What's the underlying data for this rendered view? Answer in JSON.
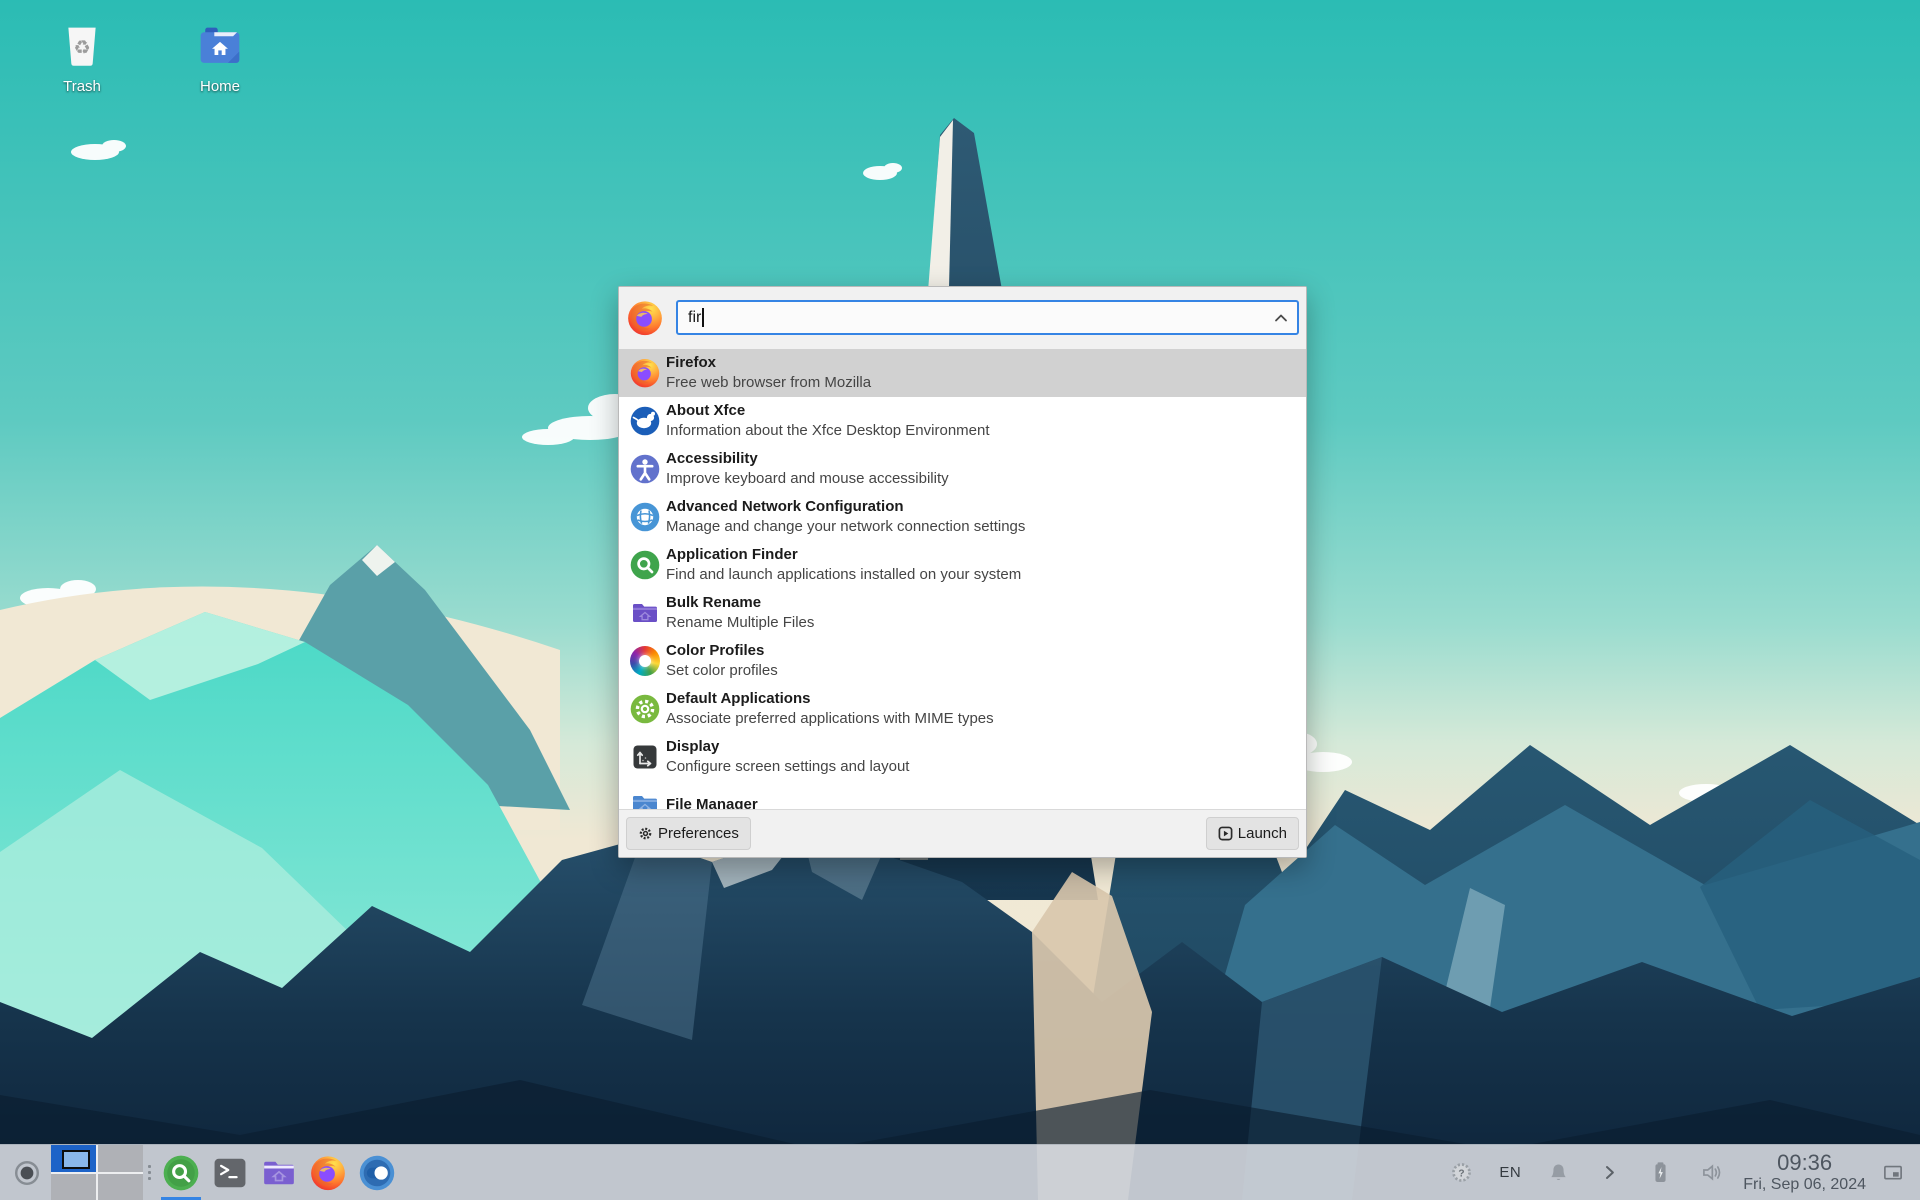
{
  "desktop": {
    "icons": [
      {
        "label": "Trash",
        "icon": "trash"
      },
      {
        "label": "Home",
        "icon": "home-folder"
      }
    ]
  },
  "finder": {
    "query": "fir",
    "search_chevron_icon": "chevron-up",
    "window_icon": "firefox",
    "results": [
      {
        "name": "Firefox",
        "description": "Free web browser from Mozilla",
        "icon": "firefox",
        "selected": true
      },
      {
        "name": "About Xfce",
        "description": "Information about the Xfce Desktop Environment",
        "icon": "about-xfce",
        "selected": false
      },
      {
        "name": "Accessibility",
        "description": "Improve keyboard and mouse accessibility",
        "icon": "accessibility",
        "selected": false
      },
      {
        "name": "Advanced Network Configuration",
        "description": "Manage and change your network connection settings",
        "icon": "network",
        "selected": false
      },
      {
        "name": "Application Finder",
        "description": "Find and launch applications installed on your system",
        "icon": "app-finder",
        "selected": false
      },
      {
        "name": "Bulk Rename",
        "description": "Rename Multiple Files",
        "icon": "bulk-rename",
        "selected": false
      },
      {
        "name": "Color Profiles",
        "description": "Set color profiles",
        "icon": "color-profiles",
        "selected": false
      },
      {
        "name": "Default Applications",
        "description": "Associate preferred applications with MIME types",
        "icon": "default-apps",
        "selected": false
      },
      {
        "name": "Display",
        "description": "Configure screen settings and layout",
        "icon": "display",
        "selected": false
      },
      {
        "name": "File Manager",
        "description": "",
        "icon": "file-manager",
        "selected": false
      }
    ],
    "preferences_label": "Preferences",
    "preferences_icon": "gear",
    "launch_label": "Launch",
    "launch_icon": "launch-play"
  },
  "taskbar": {
    "show_desktop_icon": "show-desktop",
    "workspaces": {
      "count": 4,
      "active": 0
    },
    "launchers": [
      {
        "icon": "app-finder-circle",
        "active": true
      },
      {
        "icon": "terminal",
        "active": false
      },
      {
        "icon": "file-manager-purple",
        "active": false
      },
      {
        "icon": "firefox",
        "active": false
      },
      {
        "icon": "settings-toggle",
        "active": false
      }
    ],
    "tray_icons": [
      "help",
      "language",
      "bell",
      "chevron-right",
      "battery",
      "volume"
    ],
    "language": "EN",
    "time": "09:36",
    "date": "Fri, Sep 06, 2024",
    "monitor_icon": "monitor"
  },
  "colors": {
    "accent_blue": "#3584e4",
    "selection_gray": "#d1d1d1",
    "taskbar_bg": "rgba(233,235,240,0.82)"
  }
}
